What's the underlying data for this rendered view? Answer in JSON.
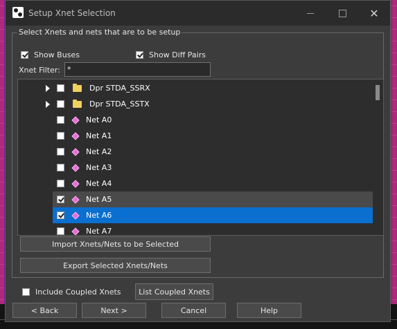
{
  "window": {
    "title": "Setup Xnet Selection"
  },
  "group": {
    "legend": "Select Xnets and nets that are to be setup"
  },
  "options": {
    "show_buses": {
      "label": "Show Buses",
      "checked": true
    },
    "show_diff_pairs": {
      "label": "Show Diff Pairs",
      "checked": true
    }
  },
  "filter": {
    "label": "Xnet Filter:",
    "value": "*"
  },
  "tree": {
    "items": [
      {
        "label": "Dpr STDA_SSRX",
        "type": "bus",
        "expandable": true,
        "checked": false,
        "state": "normal"
      },
      {
        "label": "Dpr STDA_SSTX",
        "type": "bus",
        "expandable": true,
        "checked": false,
        "state": "normal"
      },
      {
        "label": "Net A0",
        "type": "net",
        "expandable": false,
        "checked": false,
        "state": "normal"
      },
      {
        "label": "Net A1",
        "type": "net",
        "expandable": false,
        "checked": false,
        "state": "normal"
      },
      {
        "label": "Net A2",
        "type": "net",
        "expandable": false,
        "checked": false,
        "state": "normal"
      },
      {
        "label": "Net A3",
        "type": "net",
        "expandable": false,
        "checked": false,
        "state": "normal"
      },
      {
        "label": "Net A4",
        "type": "net",
        "expandable": false,
        "checked": false,
        "state": "normal"
      },
      {
        "label": "Net A5",
        "type": "net",
        "expandable": false,
        "checked": true,
        "state": "hover"
      },
      {
        "label": "Net A6",
        "type": "net",
        "expandable": false,
        "checked": true,
        "state": "selected"
      },
      {
        "label": "Net A7",
        "type": "net",
        "expandable": false,
        "checked": false,
        "state": "normal"
      }
    ]
  },
  "buttons": {
    "import_label": "Import Xnets/Nets to be Selected",
    "export_label": "Export Selected Xnets/Nets",
    "list_coupled_label": "List Coupled Xnets",
    "back_label": "< Back",
    "next_label": "Next >",
    "cancel_label": "Cancel",
    "help_label": "Help"
  },
  "include_coupled": {
    "label": "Include Coupled Xnets",
    "checked": false
  },
  "colors": {
    "selection": "#0a6fcf",
    "net_icon": "#e070d8",
    "folder_icon": "#f0d060",
    "window_bg": "#3c3c3c"
  },
  "icons": {
    "app": "app-logo-icon",
    "minimize": "minimize-icon",
    "maximize": "maximize-icon",
    "close": "close-icon",
    "bus": "folder-icon",
    "net": "net-diamond-icon",
    "expand": "expand-arrow-icon"
  }
}
